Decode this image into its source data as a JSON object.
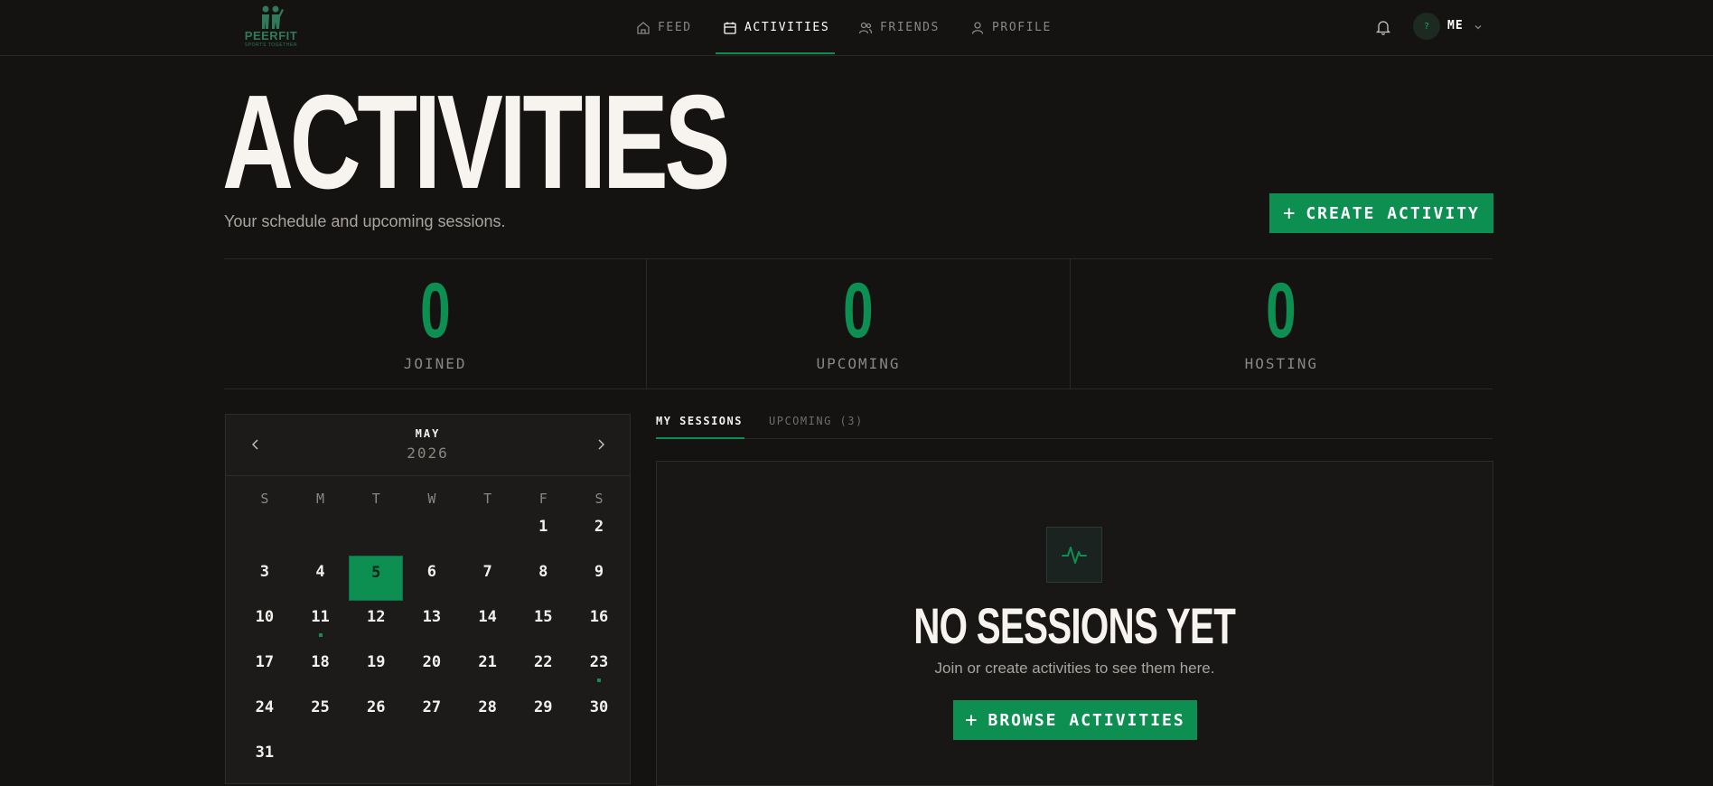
{
  "brand": {
    "name": "PEERFIT",
    "tagline": "SPORTS TOGETHER"
  },
  "nav": {
    "feed": "FEED",
    "activities": "ACTIVITIES",
    "friends": "FRIENDS",
    "profile": "PROFILE"
  },
  "user": {
    "avatar": "?",
    "name": "ME"
  },
  "header": {
    "title": "ACTIVITIES",
    "subtitle": "Your schedule and upcoming sessions.",
    "create_label": "CREATE ACTIVITY"
  },
  "stats": [
    {
      "value": "0",
      "label": "JOINED"
    },
    {
      "value": "0",
      "label": "UPCOMING"
    },
    {
      "value": "0",
      "label": "HOSTING"
    }
  ],
  "calendar": {
    "month": "MAY",
    "year": "2026",
    "weekdays": [
      "S",
      "M",
      "T",
      "W",
      "T",
      "F",
      "S"
    ],
    "selected_day": "5",
    "days_with_activity": [
      "11",
      "23"
    ],
    "weeks": [
      [
        "",
        "",
        "",
        "",
        "",
        "1",
        "2"
      ],
      [
        "3",
        "4",
        "5",
        "6",
        "7",
        "8",
        "9"
      ],
      [
        "10",
        "11",
        "12",
        "13",
        "14",
        "15",
        "16"
      ],
      [
        "17",
        "18",
        "19",
        "20",
        "21",
        "22",
        "23"
      ],
      [
        "24",
        "25",
        "26",
        "27",
        "28",
        "29",
        "30"
      ],
      [
        "31",
        "",
        "",
        "",
        "",
        "",
        ""
      ]
    ]
  },
  "tabs": {
    "my_sessions": "MY SESSIONS",
    "upcoming": "UPCOMING (3)"
  },
  "empty": {
    "title": "NO SESSIONS YET",
    "subtitle": "Join or create activities to see them here.",
    "browse_label": "BROWSE ACTIVITIES"
  },
  "colors": {
    "accent": "#0e8f52",
    "background": "#141312"
  }
}
